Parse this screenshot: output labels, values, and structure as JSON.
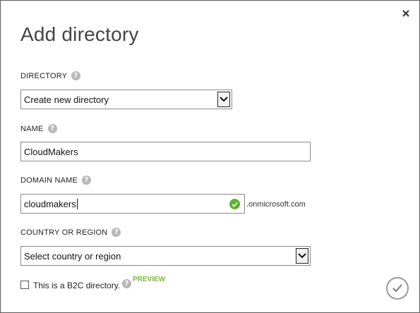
{
  "dialog": {
    "title": "Add directory",
    "close_icon": "close-icon",
    "confirm_icon": "checkmark-icon"
  },
  "directory": {
    "label": "DIRECTORY",
    "selected": "Create new directory"
  },
  "name": {
    "label": "NAME",
    "value": "CloudMakers"
  },
  "domain": {
    "label": "DOMAIN NAME",
    "value": "cloudmakers",
    "suffix": ".onmicrosoft.com",
    "status_icon": "valid-check-icon"
  },
  "country": {
    "label": "COUNTRY OR REGION",
    "selected": "Select country or region"
  },
  "b2c": {
    "label": "This is a B2C directory.",
    "checked": false,
    "badge": "PREVIEW"
  },
  "colors": {
    "accent_green": "#7fb543",
    "valid_green": "#5db12f",
    "help_gray": "#b8b8b8"
  }
}
